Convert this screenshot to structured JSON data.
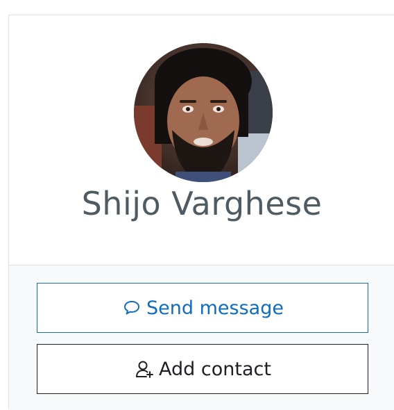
{
  "profile": {
    "name": "Shijo Varghese",
    "avatar_icon": "user-avatar-photo"
  },
  "actions": {
    "send_message_label": "Send message",
    "send_message_icon": "speech-bubble-icon",
    "add_contact_label": "Add contact",
    "add_contact_icon": "add-user-icon"
  },
  "colors": {
    "primary": "#0f6cbf",
    "dark": "#1d2125",
    "name_text": "#4f5b62",
    "footer_bg": "#f8f9fa",
    "border": "#dee2e6"
  }
}
